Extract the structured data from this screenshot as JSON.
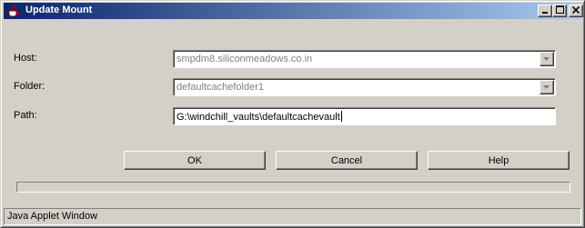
{
  "window": {
    "title": "Update Mount",
    "icon": "java-cup-icon",
    "controls": {
      "minimize": "minimize-icon",
      "maximize": "maximize-icon",
      "close": "close-icon"
    }
  },
  "form": {
    "host": {
      "label": "Host:",
      "value": "smpdm8.siliconmeadows.co.in",
      "enabled": false
    },
    "folder": {
      "label": "Folder:",
      "value": "defaultcachefolder1",
      "enabled": false
    },
    "path": {
      "label": "Path:",
      "value": "G:\\windchill_vaults\\defaultcachevault"
    }
  },
  "buttons": {
    "ok": "OK",
    "cancel": "Cancel",
    "help": "Help"
  },
  "progress": {
    "fraction": 0
  },
  "status": {
    "text": "Java Applet Window"
  },
  "colors": {
    "titlebar_start": "#0a246a",
    "titlebar_end": "#a6caf0",
    "face": "#d4d0c8"
  }
}
